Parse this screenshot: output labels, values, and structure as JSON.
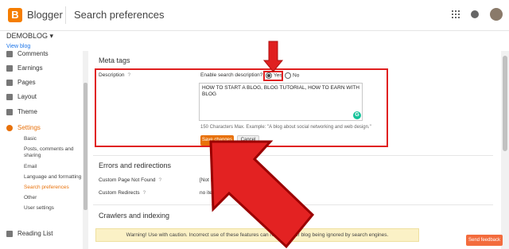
{
  "app": {
    "brand": "Blogger",
    "page_title": "Search preferences",
    "logo_letter": "B"
  },
  "blog": {
    "name": "DEMOBLOG",
    "view_link": "View blog"
  },
  "sidebar": {
    "items": [
      {
        "label": "Comments",
        "icon": "comments-icon"
      },
      {
        "label": "Earnings",
        "icon": "dollar-icon"
      },
      {
        "label": "Pages",
        "icon": "pages-icon"
      },
      {
        "label": "Layout",
        "icon": "layout-icon"
      },
      {
        "label": "Theme",
        "icon": "theme-icon"
      },
      {
        "label": "Settings",
        "icon": "gear-icon"
      },
      {
        "label": "Reading List",
        "icon": "bookmark-icon"
      }
    ],
    "subitems": [
      "Basic",
      "Posts, comments and sharing",
      "Email",
      "Language and formatting",
      "Search preferences",
      "Other",
      "User settings"
    ]
  },
  "meta_tags": {
    "title": "Meta tags",
    "description_label": "Description",
    "help": "?",
    "enable_label": "Enable search description?",
    "yes": "Yes",
    "no": "No",
    "textarea_value": "HOW TO START A BLOG, BLOG TUTORIAL,  HOW TO EARN WITH BLOG",
    "hint": "150 Characters Max. Example: \"A blog about social networking and web design.\"",
    "save": "Save changes",
    "cancel": "Cancel"
  },
  "errors": {
    "title": "Errors and redirections",
    "rows": [
      {
        "label": "Custom Page Not Found",
        "value": "[Not Set]"
      },
      {
        "label": "Custom Redirects",
        "value": "no items"
      }
    ]
  },
  "crawlers": {
    "title": "Crawlers and indexing",
    "warning": "Warning! Use with caution. Incorrect use of these features can result in your blog being ignored by search engines."
  },
  "feedback": "Send feedback",
  "colors": {
    "accent": "#e8710a",
    "highlight": "#e02020"
  }
}
